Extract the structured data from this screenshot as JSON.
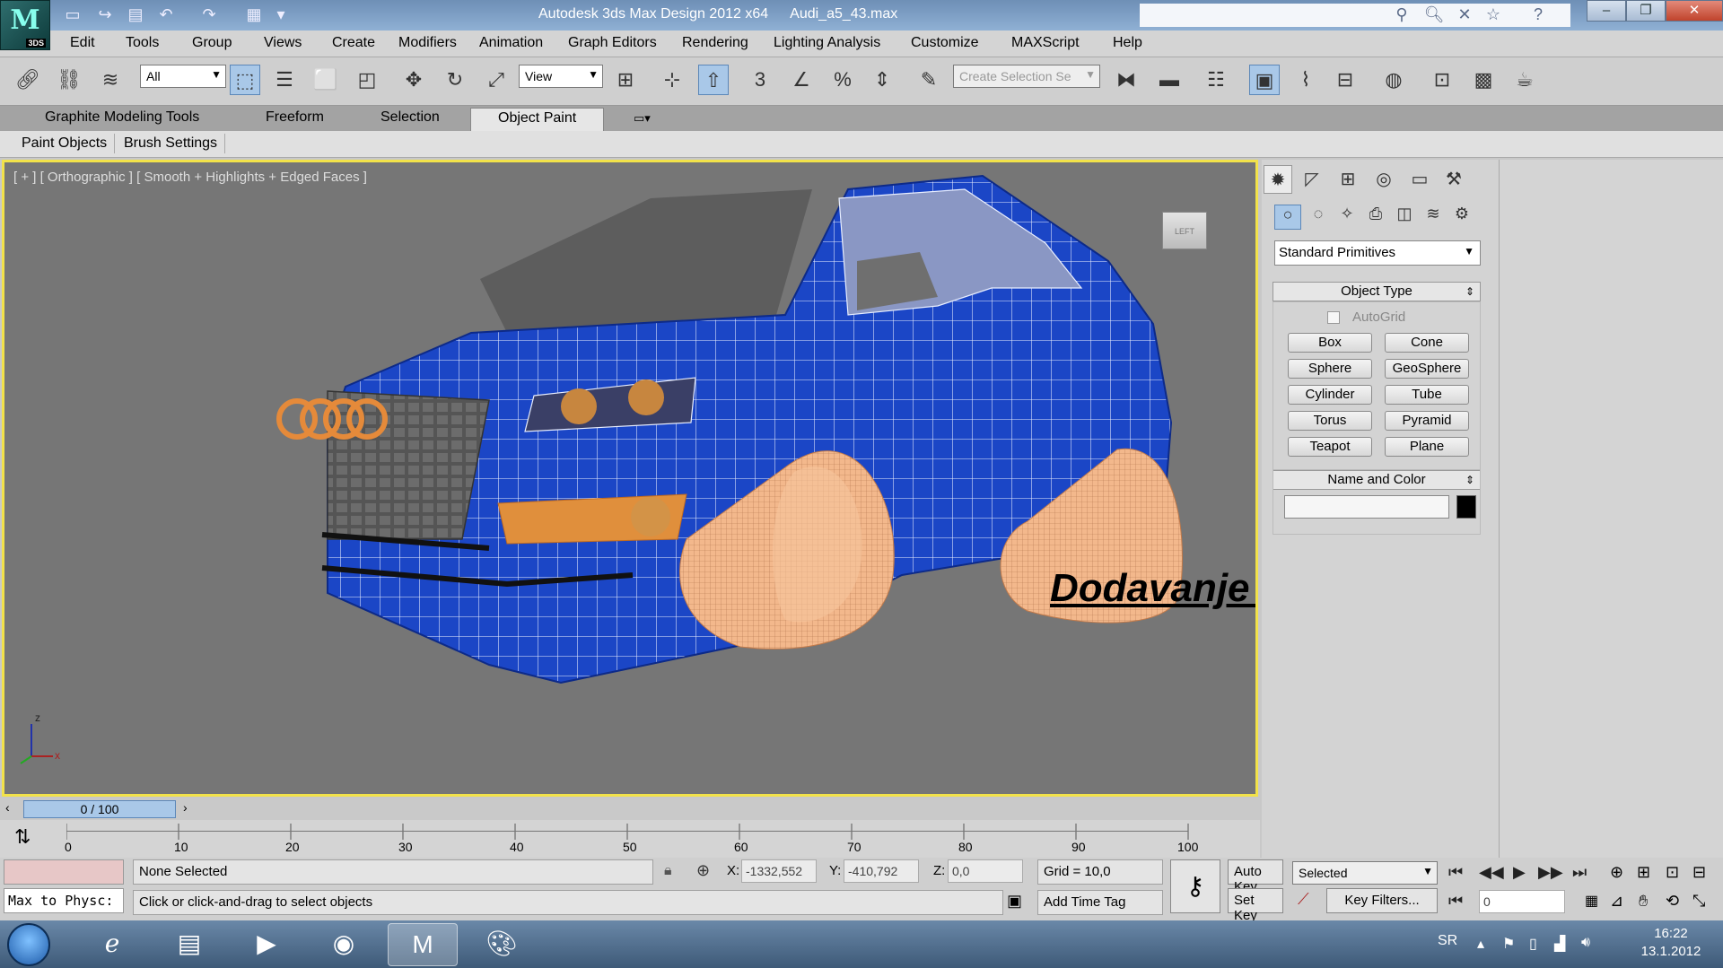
{
  "window": {
    "app_title": "Autodesk 3ds Max Design 2012 x64",
    "file_name": "Audi_a5_43.max",
    "logo_text": "M",
    "logo_badge": "3DS"
  },
  "menu": [
    "Edit",
    "Tools",
    "Group",
    "Views",
    "Create",
    "Modifiers",
    "Animation",
    "Graph Editors",
    "Rendering",
    "Lighting Analysis",
    "Customize",
    "MAXScript",
    "Help"
  ],
  "toolbar": {
    "selection_filter": "All",
    "reference_coord": "View",
    "named_selection_placeholder": "Create Selection Se",
    "snap_label": "3"
  },
  "ribbon": {
    "tabs": [
      "Graphite Modeling Tools",
      "Freeform",
      "Selection",
      "Object Paint"
    ],
    "active_tab": "Object Paint",
    "sub_tabs": [
      "Paint Objects",
      "Brush Settings"
    ]
  },
  "viewport": {
    "label": "[ + ] [ Orthographic ] [ Smooth + Highlights + Edged Faces ]",
    "overlay_caption": "Dodavanje materijala i boja",
    "viewcube_label": "LEFT",
    "axis_z": "z",
    "axis_x": "x"
  },
  "timeline": {
    "slider_text": "0 / 100",
    "frame_marks": [
      "0",
      "10",
      "20",
      "30",
      "40",
      "50",
      "60",
      "70",
      "80",
      "90",
      "100"
    ]
  },
  "status": {
    "listener_text": "Max to Physc:",
    "selection_state": "None Selected",
    "prompt": "Click or click-and-drag to select objects",
    "x_label": "X:",
    "x_value": "-1332,552",
    "y_label": "Y:",
    "y_value": "-410,792",
    "z_label": "Z:",
    "z_value": "0,0",
    "grid": "Grid = 10,0",
    "add_time_tag": "Add Time Tag",
    "auto_key": "Auto Key",
    "set_key": "Set Key",
    "key_mode": "Selected",
    "key_filters": "Key Filters...",
    "current_frame": "0"
  },
  "command_panel": {
    "primitive_category": "Standard Primitives",
    "object_type_title": "Object Type",
    "autogrid_label": "AutoGrid",
    "primitives": [
      "Box",
      "Cone",
      "Sphere",
      "GeoSphere",
      "Cylinder",
      "Tube",
      "Torus",
      "Pyramid",
      "Teapot",
      "Plane"
    ],
    "name_color_title": "Name and Color",
    "object_color": "#000000"
  },
  "taskbar": {
    "language": "SR",
    "time": "16:22",
    "date": "13.1.2012"
  },
  "colors": {
    "viewport_border": "#f2e24a",
    "car_body": "#1c47c8",
    "wheels": "#f0b488",
    "viewport_bg": "#767676"
  }
}
